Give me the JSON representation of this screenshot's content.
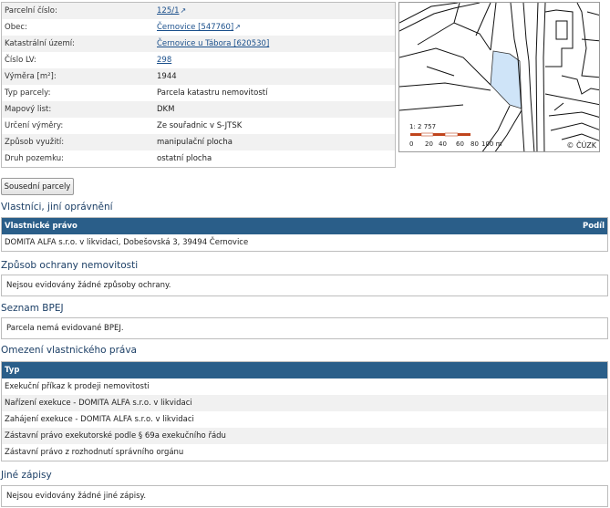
{
  "parcel": {
    "rows": [
      {
        "label": "Parcelní číslo:",
        "value": "125/1",
        "link": true,
        "external": true
      },
      {
        "label": "Obec:",
        "value": "Černovice [547760]",
        "link": true,
        "external": true
      },
      {
        "label": "Katastrální území:",
        "value": "Černovice u Tábora [620530]",
        "link": true,
        "external": false
      },
      {
        "label": "Číslo LV:",
        "value": "298",
        "link": true,
        "external": false
      },
      {
        "label": "Výměra [m²]:",
        "value": "1944",
        "link": false,
        "external": false
      },
      {
        "label": "Typ parcely:",
        "value": "Parcela katastru nemovitostí",
        "link": false,
        "external": false
      },
      {
        "label": "Mapový list:",
        "value": "DKM",
        "link": false,
        "external": false
      },
      {
        "label": "Určení výměry:",
        "value": "Ze souřadnic v S-JTSK",
        "link": false,
        "external": false
      },
      {
        "label": "Způsob využití:",
        "value": "manipulační plocha",
        "link": false,
        "external": false
      },
      {
        "label": "Druh pozemku:",
        "value": "ostatní plocha",
        "link": false,
        "external": false
      }
    ]
  },
  "map": {
    "scale_ratio": "1: 2 757",
    "scale_ticks": [
      "0",
      "20",
      "40",
      "60",
      "80",
      "100 m"
    ],
    "copyright": "© ČÚZK",
    "parcel_color": "#cfe4f8",
    "scale_colors": [
      "#c0451d",
      "#ffffff"
    ]
  },
  "neighbors_button": "Sousední parcely",
  "owners": {
    "title": "Vlastníci, jiní oprávnění",
    "col_left": "Vlastnické právo",
    "col_right": "Podíl",
    "rows": [
      "DOMITA ALFA s.r.o. v likvidaci, Dobešovská 3, 39494 Černovice"
    ]
  },
  "protection": {
    "title": "Způsob ochrany nemovitosti",
    "note": "Nejsou evidovány žádné způsoby ochrany."
  },
  "bpej": {
    "title": "Seznam BPEJ",
    "note": "Parcela nemá evidované BPEJ."
  },
  "restrictions": {
    "title": "Omezení vlastnického práva",
    "col": "Typ",
    "rows": [
      "Exekuční příkaz k prodeji nemovitosti",
      "Nařízení exekuce - DOMITA ALFA s.r.o. v likvidaci",
      "Zahájení exekuce - DOMITA ALFA s.r.o. v likvidaci",
      "Zástavní právo exekutorské podle § 69a exekučního řádu",
      "Zástavní právo z rozhodnutí správního orgánu"
    ]
  },
  "other": {
    "title": "Jiné zápisy",
    "note": "Nejsou evidovány žádné jiné zápisy."
  }
}
